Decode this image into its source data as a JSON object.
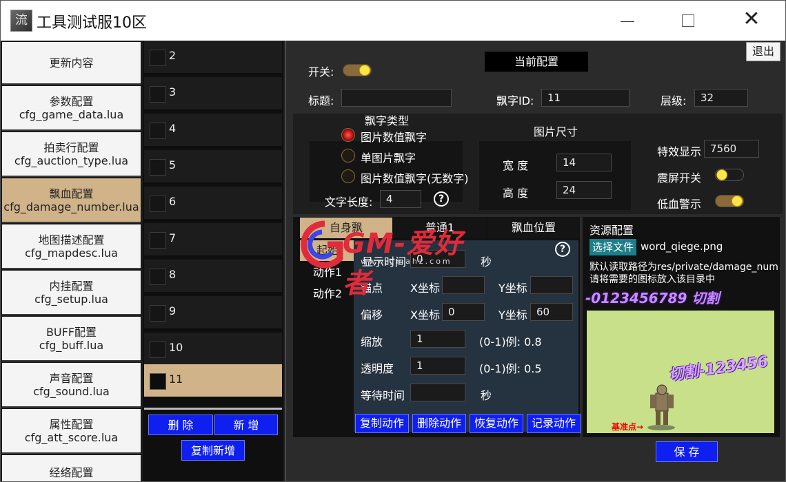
{
  "window": {
    "title": "工具测试服10区",
    "icon_char": "流"
  },
  "header": {
    "exit_label": "退出"
  },
  "sidebar": {
    "items": [
      {
        "line1": "更新内容",
        "line2": ""
      },
      {
        "line1": "参数配置",
        "line2": "cfg_game_data.lua"
      },
      {
        "line1": "拍卖行配置",
        "line2": "cfg_auction_type.lua"
      },
      {
        "line1": "飘血配置",
        "line2": "cfg_damage_number.lua"
      },
      {
        "line1": "地图描述配置",
        "line2": "cfg_mapdesc.lua"
      },
      {
        "line1": "内挂配置",
        "line2": "cfg_setup.lua"
      },
      {
        "line1": "BUFF配置",
        "line2": "cfg_buff.lua"
      },
      {
        "line1": "声音配置",
        "line2": "cfg_sound.lua"
      },
      {
        "line1": "属性配置",
        "line2": "cfg_att_score.lua"
      },
      {
        "line1": "经络配置",
        "line2": ""
      }
    ]
  },
  "numlist": {
    "items": [
      "2",
      "3",
      "4",
      "5",
      "6",
      "7",
      "8",
      "9",
      "10",
      "11"
    ],
    "delete_label": "删 除",
    "add_label": "新 增",
    "copy_add_label": "复制新增"
  },
  "config": {
    "switch_label": "开关:",
    "current_config_label": "当前配置",
    "title_label": "标题:",
    "title_value": "",
    "float_id_label": "飘字ID:",
    "float_id_value": "11",
    "layer_label": "层级:",
    "layer_value": "32",
    "float_type_label": "飘字类型",
    "float_types": [
      "图片数值飘字",
      "单图片飘字",
      "图片数值飘字(无数字)"
    ],
    "text_length_label": "文字长度:",
    "text_length_value": "4",
    "image_size_label": "图片尺寸",
    "width_label": "宽  度",
    "width_value": "14",
    "height_label": "高  度",
    "height_value": "24",
    "effect_label": "特效显示",
    "effect_value": "7560",
    "shake_label": "震屏开关",
    "lowhp_label": "低血警示"
  },
  "blood": {
    "tab_self": "自身飘",
    "tab_target": "普通1",
    "tab_position": "飘血位置",
    "sub_start": "起始",
    "sub_action1": "动作1",
    "sub_action2": "动作2",
    "display_time_label": "显示时间",
    "display_time_value": "0",
    "display_time_unit": "秒",
    "anchor_label": "锚点",
    "x_label": "X坐标",
    "y_label": "Y坐标",
    "anchor_x": "",
    "anchor_y": "",
    "offset_label": "偏移",
    "offset_x": "0",
    "offset_y": "60",
    "scale_label": "缩放",
    "scale_value": "1",
    "scale_hint": "(0-1)例: 0.8",
    "alpha_label": "透明度",
    "alpha_value": "1",
    "alpha_hint": "(0-1)例: 0.5",
    "wait_label": "等待时间",
    "wait_value": "",
    "wait_unit": "秒",
    "btn_copy": "复制动作",
    "btn_delete": "删除动作",
    "btn_restore": "恢复动作",
    "btn_record": "记录动作"
  },
  "resource": {
    "title": "资源配置",
    "choose_file": "选择文件",
    "file_name": "word_qiege.png",
    "hint1": "默认读取路径为res/private/damage_num",
    "hint2": "请将需要的图标放入该目录中",
    "preview_text": "-0123456789 切割",
    "preview_float": "切割-123456",
    "preview_anchor": "基准点→",
    "save_label": "保 存"
  },
  "watermark": {
    "text": "GM-爱好者",
    "url": "www.gmahz.com"
  },
  "colors": {
    "accent": "#d1b389",
    "blue": "#0f1ff0",
    "toggle_knob": "#ffe34a",
    "preview_bg": "#c8e08a"
  }
}
